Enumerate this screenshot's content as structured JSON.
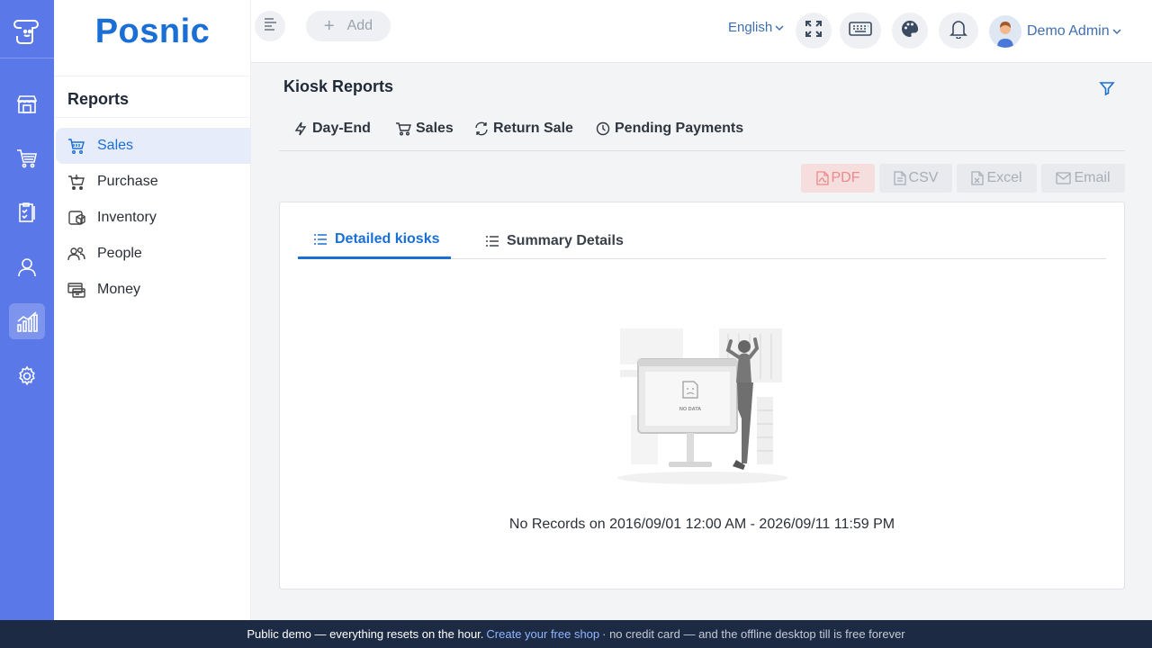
{
  "brand": {
    "name": "Posnic"
  },
  "rail": {
    "items": [
      {
        "name": "store-icon"
      },
      {
        "name": "cart-icon"
      },
      {
        "name": "clipboard-icon"
      },
      {
        "name": "user-icon"
      },
      {
        "name": "reports-chart-icon",
        "active": true
      },
      {
        "name": "settings-gear-icon"
      }
    ]
  },
  "sidebar": {
    "title": "Reports",
    "items": [
      {
        "label": "Sales",
        "icon": "basket-icon",
        "active": true
      },
      {
        "label": "Purchase",
        "icon": "purchase-cart-icon"
      },
      {
        "label": "Inventory",
        "icon": "box-icon"
      },
      {
        "label": "People",
        "icon": "people-icon"
      },
      {
        "label": "Money",
        "icon": "money-icon"
      }
    ]
  },
  "header": {
    "add_label": "Add",
    "language": "English",
    "user_name": "Demo Admin"
  },
  "page": {
    "title": "Kiosk Reports",
    "tabs": [
      {
        "label": "Day-End",
        "icon": "lightning-icon"
      },
      {
        "label": "Sales",
        "icon": "cart-icon"
      },
      {
        "label": "Return Sale",
        "icon": "refresh-icon"
      },
      {
        "label": "Pending Payments",
        "icon": "clock-icon"
      }
    ],
    "exports": [
      {
        "label": "PDF",
        "icon": "pdf-file-icon"
      },
      {
        "label": "CSV",
        "icon": "csv-file-icon"
      },
      {
        "label": "Excel",
        "icon": "excel-file-icon"
      },
      {
        "label": "Email",
        "icon": "mail-icon"
      }
    ],
    "inner_tabs": [
      {
        "label": "Detailed kiosks",
        "active": true
      },
      {
        "label": "Summary Details"
      }
    ],
    "empty_illustration_text": "NO DATA",
    "empty_message": "No Records on 2016/09/01 12:00 AM - 2026/09/11 11:59 PM"
  },
  "banner": {
    "text_before": "Public demo — everything resets on the hour.",
    "link": "Create your free shop",
    "text_after": "· no credit card — and the offline desktop till is free forever"
  },
  "colors": {
    "rail": "#5a78e8",
    "accent": "#1a6fd6",
    "banner": "#1d2a44"
  }
}
